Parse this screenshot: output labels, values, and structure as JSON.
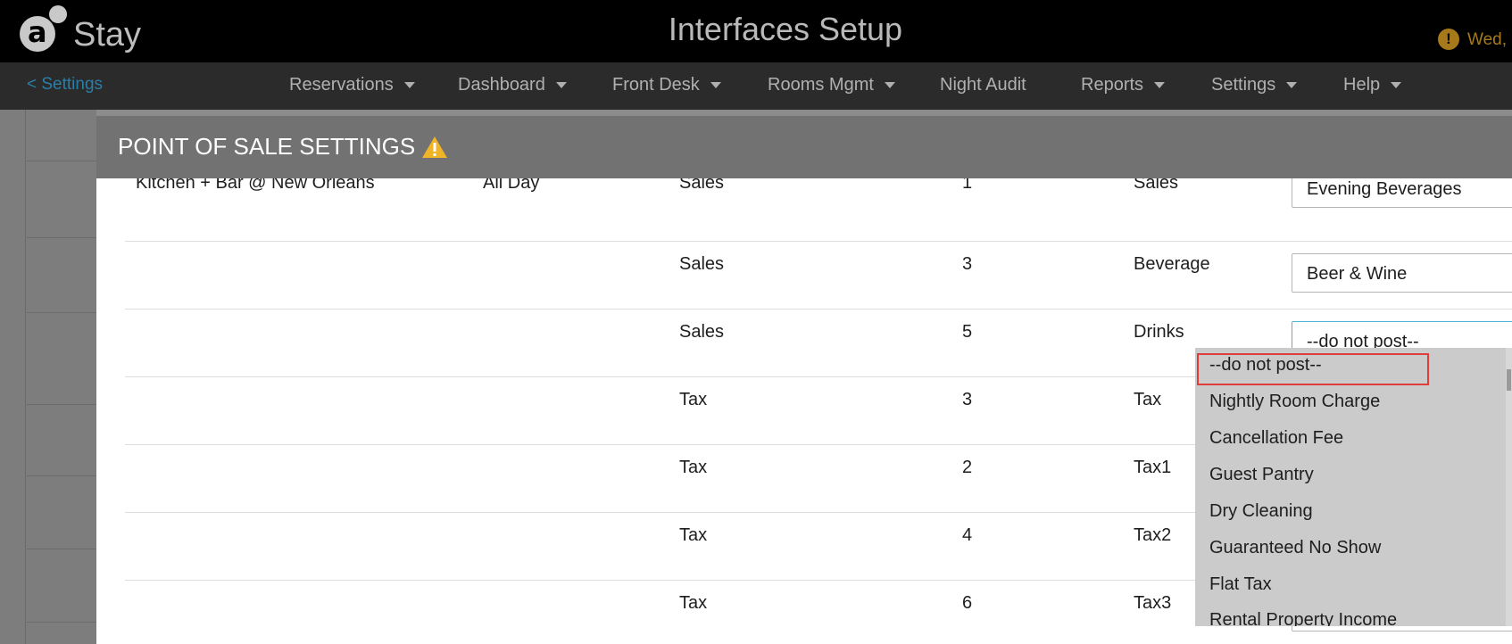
{
  "header": {
    "logo_letter": "a",
    "logo_text": "Stay",
    "title": "Interfaces Setup",
    "alert_icon": "exclamation-circle-icon",
    "date_text": "Wed,"
  },
  "nav": {
    "back_label": "< Settings",
    "items": [
      {
        "label": "Reservations"
      },
      {
        "label": "Dashboard"
      },
      {
        "label": "Front Desk"
      },
      {
        "label": "Rooms Mgmt"
      },
      {
        "label": "Night Audit"
      },
      {
        "label": "Reports"
      },
      {
        "label": "Settings"
      },
      {
        "label": "Help"
      }
    ]
  },
  "modal": {
    "title": "POINT OF SALE SETTINGS",
    "warning_icon": "warning-triangle-icon",
    "rows": [
      {
        "outlet": "Kitchen + Bar @ New Orleans",
        "period": "All Day",
        "type": "Sales",
        "number": "1",
        "category": "Sales",
        "selected": "Evening Beverages"
      },
      {
        "outlet": "",
        "period": "",
        "type": "Sales",
        "number": "3",
        "category": "Beverage",
        "selected": "Beer & Wine"
      },
      {
        "outlet": "",
        "period": "",
        "type": "Sales",
        "number": "5",
        "category": "Drinks",
        "selected": "--do not post--"
      },
      {
        "outlet": "",
        "period": "",
        "type": "Tax",
        "number": "3",
        "category": "Tax",
        "selected": ""
      },
      {
        "outlet": "",
        "period": "",
        "type": "Tax",
        "number": "2",
        "category": "Tax1",
        "selected": ""
      },
      {
        "outlet": "",
        "period": "",
        "type": "Tax",
        "number": "4",
        "category": "Tax2",
        "selected": ""
      },
      {
        "outlet": "",
        "period": "",
        "type": "Tax",
        "number": "6",
        "category": "Tax3",
        "selected": ""
      }
    ]
  },
  "dropdown": {
    "options": [
      "--do not post--",
      "Nightly Room Charge",
      "Cancellation Fee",
      "Guest Pantry",
      "Dry Cleaning",
      "Guaranteed No Show",
      "Flat Tax",
      "Rental Property Income"
    ],
    "highlighted_index": 0
  },
  "colors": {
    "accent_link": "#2a7ea8",
    "alert": "#a67a1a",
    "focus_border": "#4fb4d8",
    "highlight_border": "#e03c3c",
    "warning": "#f0b429"
  }
}
